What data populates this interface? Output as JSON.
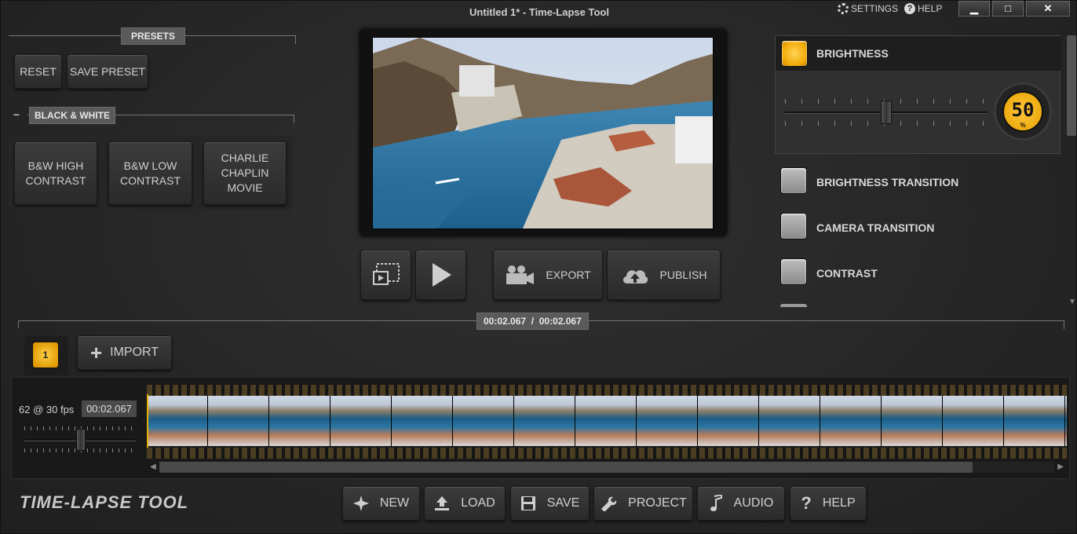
{
  "window": {
    "title": "Untitled 1* - Time-Lapse Tool",
    "settings_label": "SETTINGS",
    "help_label": "HELP",
    "minimize_label": "▁",
    "maximize_label": "□",
    "close_label": "✕"
  },
  "presets": {
    "header": "PRESETS",
    "reset_label": "RESET",
    "save_preset_label": "SAVE PRESET",
    "group_header": "BLACK & WHITE",
    "group_collapse_label": "–",
    "items": [
      {
        "label": "B&W HIGH CONTRAST"
      },
      {
        "label": "B&W LOW CONTRAST"
      },
      {
        "label": "CHARLIE CHAPLIN MOVIE"
      }
    ]
  },
  "playback": {
    "export_label": "EXPORT",
    "publish_label": "PUBLISH"
  },
  "adjustments": {
    "brightness": {
      "label": "BRIGHTNESS",
      "enabled": true,
      "value": "50",
      "unit": "%"
    },
    "items": [
      {
        "label": "BRIGHTNESS TRANSITION",
        "enabled": false
      },
      {
        "label": "CAMERA TRANSITION",
        "enabled": false
      },
      {
        "label": "CONTRAST",
        "enabled": false
      }
    ]
  },
  "timeline": {
    "time_display": "00:02.067  /  00:02.067",
    "track_number": "1",
    "import_label": "IMPORT",
    "frames_info": "62 @ 30 fps",
    "duration": "00:02.067",
    "frame_count_shown": 16
  },
  "toolbar": {
    "brand": "TIME-LAPSE TOOL",
    "new_label": "NEW",
    "load_label": "LOAD",
    "save_label": "SAVE",
    "project_label": "PROJECT",
    "audio_label": "AUDIO",
    "help_label": "HELP"
  },
  "colors": {
    "accent": "#f0a800",
    "background": "#2a2a2a"
  }
}
